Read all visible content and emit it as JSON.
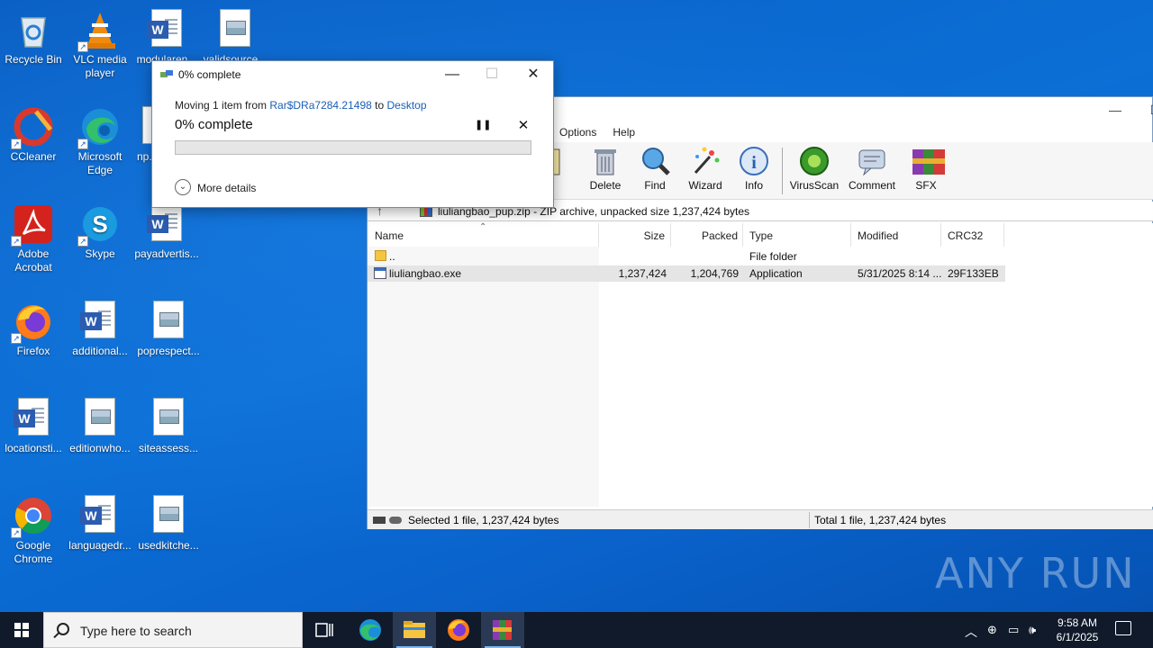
{
  "desktop": {
    "icons": [
      {
        "label": "Recycle Bin"
      },
      {
        "label": "VLC media player"
      },
      {
        "label": "modularen..."
      },
      {
        "label": "validsource..."
      },
      {
        "label": "CCleaner"
      },
      {
        "label": "Microsoft Edge"
      },
      {
        "label": "np..."
      },
      {
        "label": "Adobe Acrobat"
      },
      {
        "label": "Skype"
      },
      {
        "label": "payadvertis..."
      },
      {
        "label": "Firefox"
      },
      {
        "label": "additional..."
      },
      {
        "label": "poprespect..."
      },
      {
        "label": "locationsti..."
      },
      {
        "label": "editionwho..."
      },
      {
        "label": "siteassess..."
      },
      {
        "label": "Google Chrome"
      },
      {
        "label": "languagedr..."
      },
      {
        "label": "usedkitche..."
      }
    ]
  },
  "copy_dialog": {
    "title": "0% complete",
    "moving_prefix": "Moving 1 item from ",
    "source": "Rar$DRa7284.21498",
    "moving_to": " to ",
    "destination": "Desktop",
    "percent_text": "0% complete",
    "progress": 0,
    "more_details": "More details"
  },
  "winrar": {
    "menu": [
      "Options",
      "Help"
    ],
    "toolbar": [
      {
        "label": "iew",
        "icon": "view-icon"
      },
      {
        "label": "Delete",
        "icon": "delete-icon"
      },
      {
        "label": "Find",
        "icon": "find-icon"
      },
      {
        "label": "Wizard",
        "icon": "wizard-icon"
      },
      {
        "label": "Info",
        "icon": "info-icon"
      },
      {
        "label": "VirusScan",
        "icon": "virusscan-icon"
      },
      {
        "label": "Comment",
        "icon": "comment-icon"
      },
      {
        "label": "SFX",
        "icon": "sfx-icon"
      }
    ],
    "path_text": "liuliangbao_pup.zip - ZIP archive, unpacked size 1,237,424 bytes",
    "columns": [
      "Name",
      "Size",
      "Packed",
      "Type",
      "Modified",
      "CRC32"
    ],
    "rows": [
      {
        "name": "..",
        "size": "",
        "packed": "",
        "type": "File folder",
        "modified": "",
        "crc": ""
      },
      {
        "name": "liuliangbao.exe",
        "size": "1,237,424",
        "packed": "1,204,769",
        "type": "Application",
        "modified": "5/31/2025 8:14 ...",
        "crc": "29F133EB"
      }
    ],
    "status_left": "Selected 1 file, 1,237,424 bytes",
    "status_right": "Total 1 file, 1,237,424 bytes"
  },
  "watermark": "ANY RUN",
  "taskbar": {
    "search_placeholder": "Type here to search",
    "time": "9:58 AM",
    "date": "6/1/2025"
  }
}
